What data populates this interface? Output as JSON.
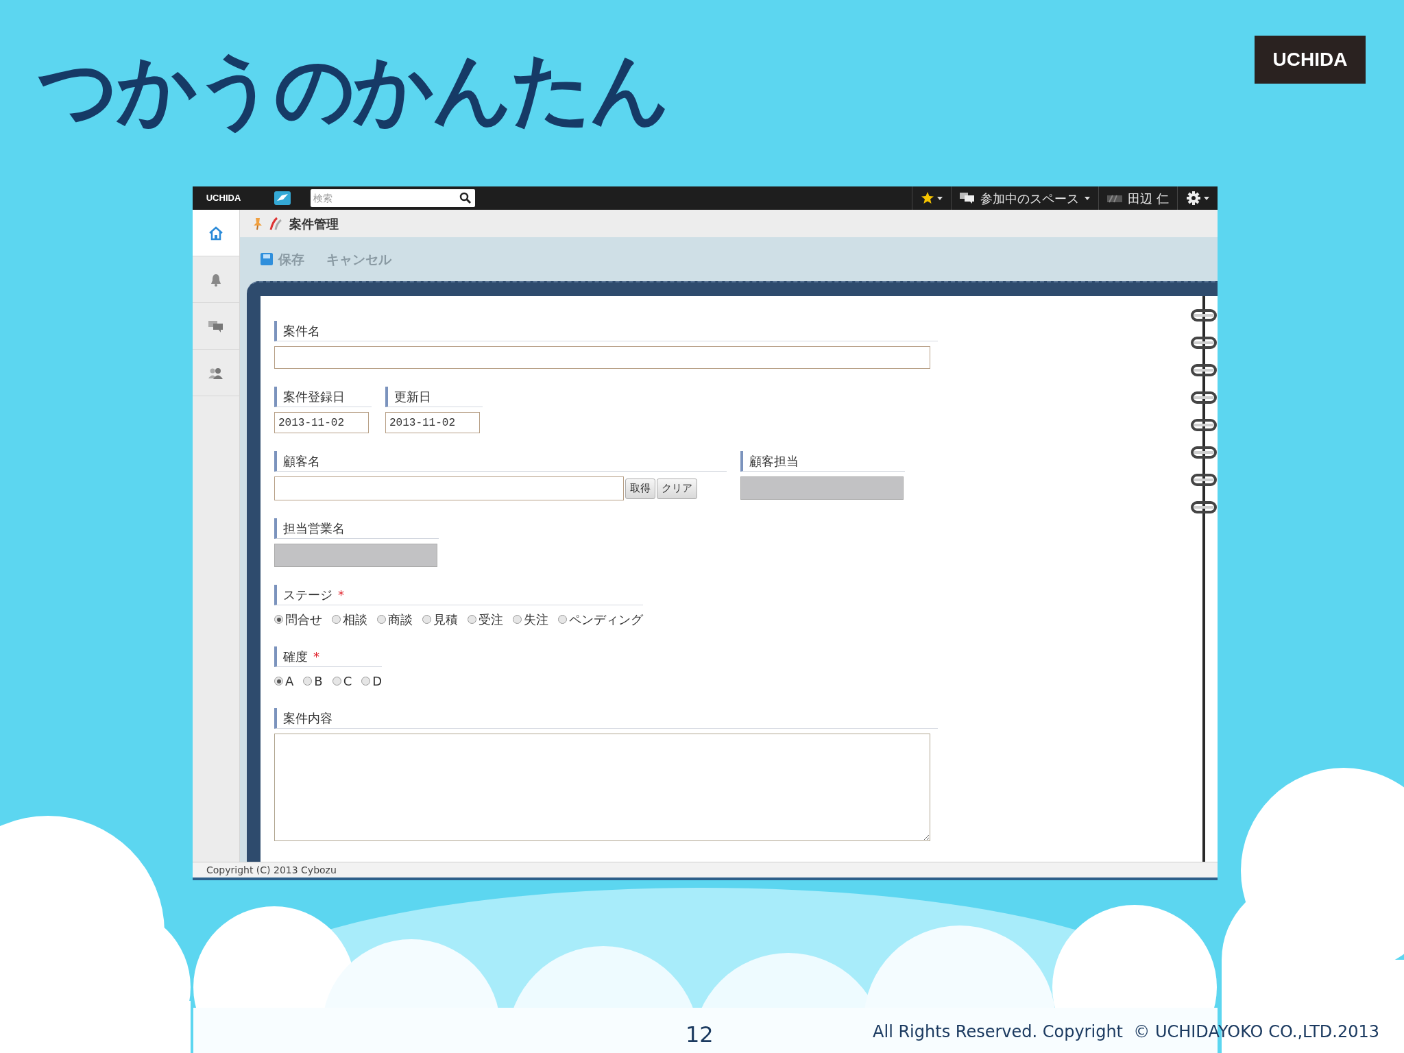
{
  "slide": {
    "title": "つかうのかんたん",
    "logo": "UCHIDA",
    "page_number": "12",
    "copyright": "All Rights Reserved. Copyright  © UCHIDAYOKO CO.,LTD.2013"
  },
  "app": {
    "top_bar": {
      "logo": "UCHIDA",
      "search": {
        "placeholder": "検索"
      },
      "spaces": "参加中のスペース",
      "user": "田辺 仁"
    },
    "sidebar": {
      "items": [
        {
          "kind": "home",
          "selected": true
        },
        {
          "kind": "bell",
          "selected": false
        },
        {
          "kind": "chat",
          "selected": false
        },
        {
          "kind": "people",
          "selected": false
        }
      ]
    },
    "breadcrumb": "案件管理",
    "toolbar": [
      {
        "kind": "save",
        "label": "保存"
      },
      {
        "kind": "cancel",
        "label": "キャンセル"
      }
    ],
    "form": {
      "rows": [
        {
          "fields": [
            {
              "kind": "text",
              "label": "案件名"
            }
          ]
        },
        {
          "fields": [
            {
              "kind": "date",
              "label": "案件登録日",
              "value": "2013-11-02"
            },
            {
              "kind": "date",
              "label": "更新日",
              "value": "2013-11-02"
            }
          ]
        },
        {
          "fields": [
            {
              "kind": "lookup",
              "label": "顧客名",
              "buttons": [
                "取得",
                "クリア"
              ]
            },
            {
              "kind": "readonly",
              "label": "顧客担当"
            }
          ]
        },
        {
          "fields": [
            {
              "kind": "readonly",
              "label": "担当営業名"
            }
          ]
        },
        {
          "fields": [
            {
              "kind": "radio",
              "label": "ステージ",
              "required_mark": "*",
              "options": [
                {
                  "label": "問合せ",
                  "selected": true
                },
                {
                  "label": "相談",
                  "selected": false
                },
                {
                  "label": "商談",
                  "selected": false
                },
                {
                  "label": "見積",
                  "selected": false
                },
                {
                  "label": "受注",
                  "selected": false
                },
                {
                  "label": "失注",
                  "selected": false
                },
                {
                  "label": "ペンディング",
                  "selected": false
                }
              ]
            }
          ]
        },
        {
          "fields": [
            {
              "kind": "radio",
              "label": "確度",
              "required_mark": "*",
              "options": [
                {
                  "label": "A",
                  "selected": true
                },
                {
                  "label": "B",
                  "selected": false
                },
                {
                  "label": "C",
                  "selected": false
                },
                {
                  "label": "D",
                  "selected": false
                }
              ]
            }
          ]
        },
        {
          "fields": [
            {
              "kind": "textarea",
              "label": "案件内容"
            }
          ]
        }
      ]
    },
    "footer": "Copyright (C) 2013 Cybozu"
  }
}
